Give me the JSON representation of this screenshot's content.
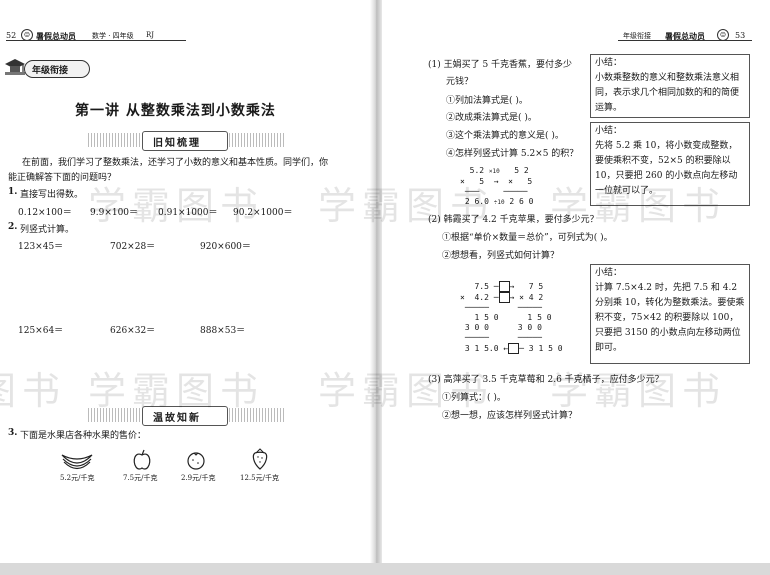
{
  "left": {
    "page_number": "52",
    "header_title": "暑假总动员",
    "header_subject": "数学 · 四年级",
    "header_edition": "RJ",
    "badge": "年级衔接",
    "lesson_title": "第一讲   从整数乘法到小数乘法",
    "section1": "旧知梳理",
    "intro1": "在前面，我们学习了整数乘法，还学习了小数的意义和基本性质。同学们，你",
    "intro2": "能正确解答下面的问题吗？",
    "q1_label": "1.",
    "q1_text": "直接写出得数。",
    "q1_items": [
      "0.12×100＝",
      "9.9×100＝",
      "0.91×1000＝",
      "90.2×1000＝"
    ],
    "q2_label": "2.",
    "q2_text": "列竖式计算。",
    "q2_row1": [
      "123×45＝",
      "702×28＝",
      "920×600＝"
    ],
    "q2_row2": [
      "125×64＝",
      "626×32＝",
      "888×53＝"
    ],
    "section2": "温故知新",
    "q3_label": "3.",
    "q3_text": "下面是水果店各种水果的售价：",
    "prices": [
      "5.2元/千克",
      "7.5元/千克",
      "2.9元/千克",
      "12.5元/千克"
    ]
  },
  "right": {
    "header_left": "年级衔接",
    "header_title": "暑假总动员",
    "page_number": "53",
    "p1": "(1) 王娟买了 5 千克香蕉，要付多少",
    "p1b": "元钱？",
    "p1_s1": "①列加法算式是(                  )。",
    "p1_s2": "②改成乘法算式是(              )。",
    "p1_s3": "③这个乘法算式的意义是(        )。",
    "p1_s4": "④怎样列竖式计算 5.2×5 的积？",
    "summary1_title": "小结：",
    "summary1_text": "小数乘整数的意义和整数乘法意义相同，表示求几个相同加数的和的简便运算。",
    "summary2_title": "小结：",
    "summary2_text": "先将 5.2 乘 10，将小数变成整数，要使乘积不变，52×5 的积要除以 10，只要把 260 的小数点向左移动一位就可以了。",
    "p2": "(2) 韩霞买了 4.2 千克苹果，要付多少元？",
    "p2_s1": "①根据“单价×数量＝总价”，可列式为(              )。",
    "p2_s2": "②想想看，列竖式如何计算？",
    "summary3_title": "小结：",
    "summary3_text": "计算 7.5×4.2 时，先把 7.5 和 4.2 分别乘 10，转化为整数乘法。要使乘积不变，75×42 的积要除以 100，只要把 3150 的小数点向左移动两位即可。",
    "p3": "(3) 高萍买了 3.5 千克草莓和 2.6 千克橘子，应付多少元？",
    "p3_s1": "①列算式：(                          )。",
    "p3_s2": "②想一想，应该怎样列竖式计算？"
  },
  "watermark": "学霸图书"
}
